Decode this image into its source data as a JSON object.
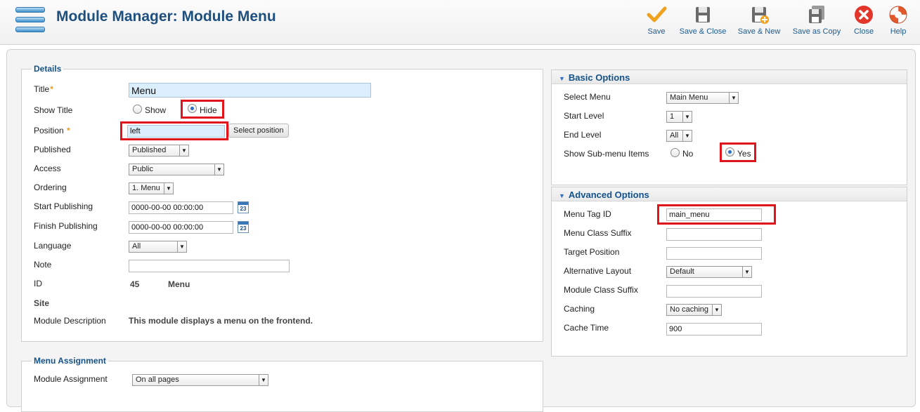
{
  "header": {
    "title": "Module Manager: Module Menu"
  },
  "toolbar": {
    "save": "Save",
    "save_close": "Save & Close",
    "save_new": "Save & New",
    "save_copy": "Save as Copy",
    "close": "Close",
    "help": "Help"
  },
  "details": {
    "legend": "Details",
    "title_label": "Title",
    "title_value": "Menu",
    "show_title_label": "Show Title",
    "show_option": "Show",
    "hide_option": "Hide",
    "position_label": "Position",
    "position_value": "left",
    "select_position": "Select position",
    "published_label": "Published",
    "published_value": "Published",
    "access_label": "Access",
    "access_value": "Public",
    "ordering_label": "Ordering",
    "ordering_value": "1. Menu",
    "start_publishing_label": "Start Publishing",
    "start_publishing_value": "0000-00-00 00:00:00",
    "finish_publishing_label": "Finish Publishing",
    "finish_publishing_value": "0000-00-00 00:00:00",
    "calendar_day": "23",
    "language_label": "Language",
    "language_value": "All",
    "note_label": "Note",
    "note_value": "",
    "id_label": "ID",
    "id_value": "45",
    "id_type": "Menu",
    "site_label": "Site",
    "description_label": "Module Description",
    "description_value": "This module displays a menu on the frontend."
  },
  "menu_assignment": {
    "legend": "Menu Assignment",
    "module_assignment_label": "Module Assignment",
    "module_assignment_value": "On all pages"
  },
  "basic_options": {
    "heading": "Basic Options",
    "select_menu_label": "Select Menu",
    "select_menu_value": "Main Menu",
    "start_level_label": "Start Level",
    "start_level_value": "1",
    "end_level_label": "End Level",
    "end_level_value": "All",
    "show_submenu_label": "Show Sub-menu Items",
    "no_option": "No",
    "yes_option": "Yes"
  },
  "advanced_options": {
    "heading": "Advanced Options",
    "menu_tag_id_label": "Menu Tag ID",
    "menu_tag_id_value": "main_menu",
    "menu_class_suffix_label": "Menu Class Suffix",
    "menu_class_suffix_value": "",
    "target_position_label": "Target Position",
    "target_position_value": "",
    "alt_layout_label": "Alternative Layout",
    "alt_layout_value": "Default",
    "module_class_suffix_label": "Module Class Suffix",
    "module_class_suffix_value": "",
    "caching_label": "Caching",
    "caching_value": "No caching",
    "cache_time_label": "Cache Time",
    "cache_time_value": "900"
  },
  "colors": {
    "title": "#1d4f7f",
    "legend": "#14528a",
    "highlight_box": "#e1141b",
    "required_star": "#e89a1f"
  }
}
